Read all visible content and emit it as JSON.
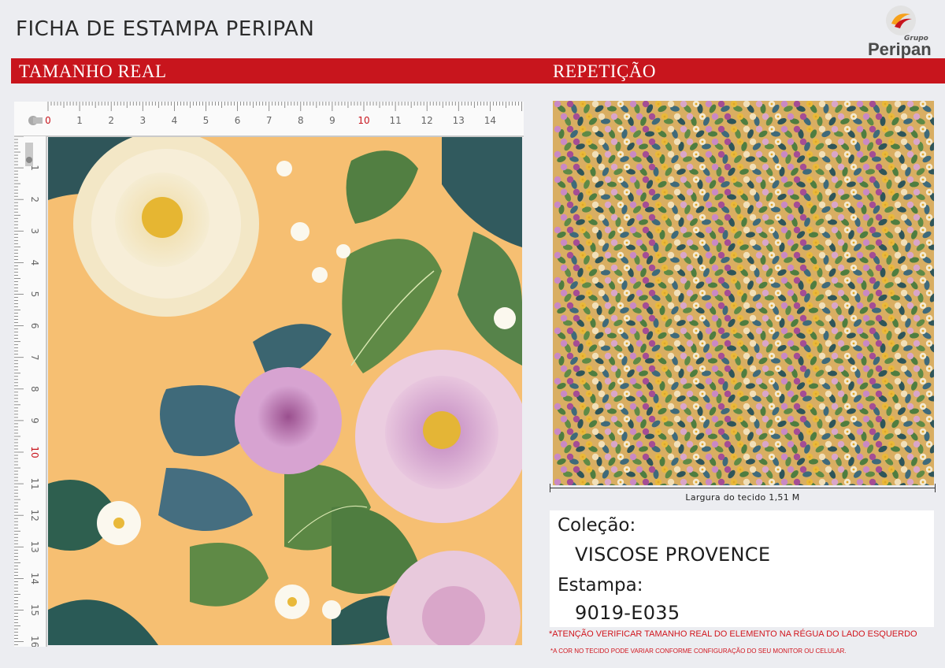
{
  "header": {
    "title": "FICHA DE ESTAMPA PERIPAN",
    "logo": {
      "grupo": "Grupo",
      "name": "Peripan",
      "colors": [
        "#f7a11a",
        "#c8151d",
        "#e2e2e2"
      ]
    }
  },
  "sections": {
    "left_title": "TAMANHO REAL",
    "right_title": "REPETIÇÃO"
  },
  "ruler": {
    "top_numbers": [
      "0",
      "1",
      "2",
      "3",
      "4",
      "5",
      "6",
      "7",
      "8",
      "9",
      "10",
      "11",
      "12",
      "13",
      "14"
    ],
    "left_numbers": [
      "1",
      "2",
      "3",
      "4",
      "5",
      "6",
      "7",
      "8",
      "9",
      "10",
      "11",
      "12",
      "13",
      "14",
      "15",
      "16"
    ],
    "unit": "cm"
  },
  "fabric": {
    "width_label": "Largura do tecido 1,51 M",
    "background_color": "#f6bf72"
  },
  "info": {
    "collection_label": "Coleção:",
    "collection_value": "VISCOSE PROVENCE",
    "print_label": "Estampa:",
    "print_value": "9019-E035"
  },
  "notes": {
    "warning_size": "*ATENÇÃO VERIFICAR TAMANHO REAL DO ELEMENTO NA RÉGUA DO LADO ESQUERDO",
    "warning_color": "*A COR NO TECIDO PODE VARIAR CONFORME CONFIGURAÇÃO DO SEU MONITOR OU CELULAR."
  },
  "colors": {
    "accent_red": "#c8151d",
    "page_bg": "#ecedf1"
  }
}
